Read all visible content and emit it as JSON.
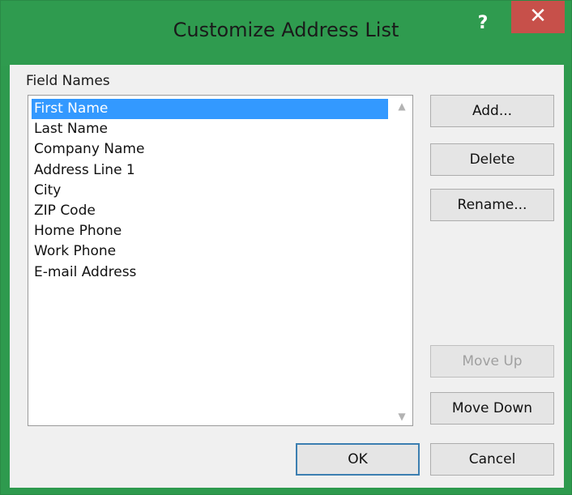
{
  "window": {
    "title": "Customize Address List",
    "help_glyph": "?",
    "close_glyph": "✕"
  },
  "field_names": {
    "label": "Field Names",
    "items": [
      "First Name",
      "Last Name",
      "Company Name",
      "Address Line 1",
      "City",
      "ZIP Code",
      "Home Phone",
      "Work Phone",
      "E-mail Address"
    ],
    "selected_index": 0
  },
  "buttons": {
    "add": "Add...",
    "delete": "Delete",
    "rename": "Rename...",
    "move_up": "Move Up",
    "move_down": "Move Down",
    "ok": "OK",
    "cancel": "Cancel"
  }
}
